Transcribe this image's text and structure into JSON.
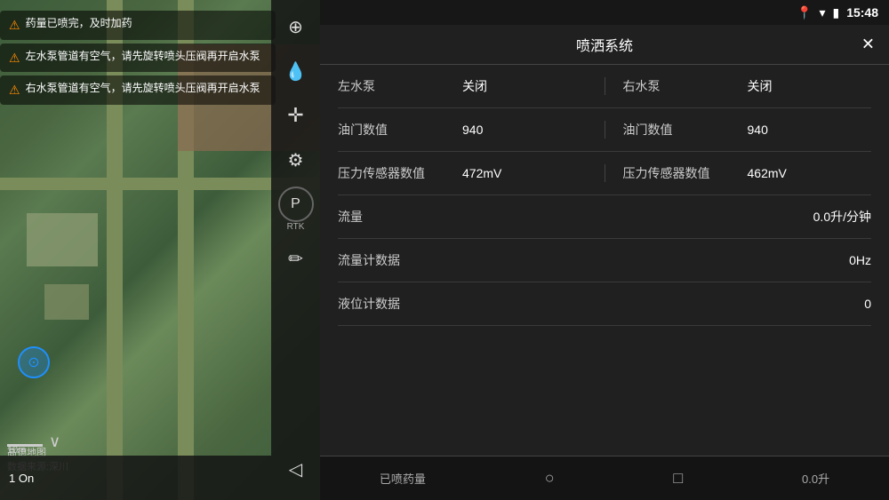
{
  "app": {
    "title": "喷洒系统",
    "close_label": "✕"
  },
  "status_bar": {
    "time": "15:48",
    "location_icon": "📍",
    "wifi_icon": "▾",
    "battery_icon": "🔋"
  },
  "alerts": [
    {
      "icon": "⚠",
      "text": "药量已喷完，及时加药"
    },
    {
      "icon": "⚠",
      "text": "左水泵管道有空气，请先旋转喷头压阀再开启水泵"
    },
    {
      "icon": "⚠",
      "text": "右水泵管道有空气，请先旋转喷头压阀再开启水泵"
    }
  ],
  "sidebar": {
    "icons": [
      {
        "name": "target-icon",
        "symbol": "⊕",
        "active": false
      },
      {
        "name": "spray-icon",
        "symbol": "💧",
        "active": true
      },
      {
        "name": "drone-icon",
        "symbol": "✛",
        "active": false
      },
      {
        "name": "settings-icon",
        "symbol": "⚙",
        "active": false
      },
      {
        "name": "rtk-icon",
        "symbol": "P",
        "label": "RTK",
        "active": false
      },
      {
        "name": "route-icon",
        "symbol": "✏",
        "active": false
      }
    ],
    "bottom_icon": "◁"
  },
  "panel": {
    "rows": [
      {
        "type": "dual",
        "left_label": "左水泵",
        "left_value": "关闭",
        "right_label": "右水泵",
        "right_value": "关闭"
      },
      {
        "type": "dual",
        "left_label": "油门数值",
        "left_value": "940",
        "right_label": "油门数值",
        "right_value": "940"
      },
      {
        "type": "dual",
        "left_label": "压力传感器数值",
        "left_value": "472mV",
        "right_label": "压力传感器数值",
        "right_value": "462mV"
      },
      {
        "type": "single",
        "label": "流量",
        "value": "0.0升/分钟"
      },
      {
        "type": "single",
        "label": "流量计数据",
        "value": "0Hz"
      },
      {
        "type": "single",
        "label": "液位计数据",
        "value": "0"
      }
    ]
  },
  "bottom_nav": {
    "items": [
      {
        "label": "已喷药量",
        "icon": ""
      },
      {
        "label": "",
        "icon": "○"
      },
      {
        "label": "",
        "icon": "□"
      },
      {
        "label": "0.0升",
        "icon": ""
      }
    ]
  },
  "bottom_left": {
    "text": "1 On"
  },
  "map": {
    "scale_label": "10m",
    "provider": "高德地图",
    "sub_label": "数据来源:深川"
  }
}
